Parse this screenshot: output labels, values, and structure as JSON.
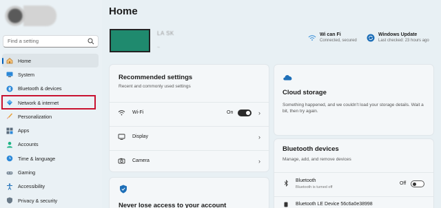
{
  "search": {
    "placeholder": "Find a setting"
  },
  "sidebar": {
    "items": [
      {
        "label": "Home",
        "icon": "home-icon",
        "active": true
      },
      {
        "label": "System",
        "icon": "monitor-icon"
      },
      {
        "label": "Bluetooth & devices",
        "icon": "bluetooth-icon"
      },
      {
        "label": "Network & internet",
        "icon": "network-diamond-icon"
      },
      {
        "label": "Personalization",
        "icon": "brush-icon"
      },
      {
        "label": "Apps",
        "icon": "apps-grid-icon"
      },
      {
        "label": "Accounts",
        "icon": "person-icon"
      },
      {
        "label": "Time & language",
        "icon": "globe-clock-icon"
      },
      {
        "label": "Gaming",
        "icon": "gamepad-icon"
      },
      {
        "label": "Accessibility",
        "icon": "accessibility-icon"
      },
      {
        "label": "Privacy & security",
        "icon": "shield-icon"
      }
    ]
  },
  "main": {
    "title": "Home",
    "device_name": "LA         SK"
  },
  "status": {
    "wifi": {
      "title": "Wi can Fi",
      "sub": "Connected, secured"
    },
    "update": {
      "title": "Windows Update",
      "sub": "Last checked: 23 hours ago"
    }
  },
  "recommended": {
    "title": "Recommended settings",
    "sub": "Recent and commonly used settings",
    "rows": [
      {
        "label": "Wi-Fi",
        "state": "On"
      },
      {
        "label": "Display"
      },
      {
        "label": "Camera"
      }
    ]
  },
  "cloud": {
    "title": "Cloud storage",
    "body": "Something happened, and we couldn't load your storage details. Wait a bit, then try again."
  },
  "bluetooth": {
    "title": "Bluetooth devices",
    "sub": "Manage, add, and remove devices",
    "row_label": "Bluetooth",
    "row_sub": "Bluetooth is turned off",
    "row_state": "Off",
    "device": "Bluetooth LE Device 56c6a0e38998"
  },
  "account": {
    "title": "Never lose access to your account"
  },
  "colors": {
    "accent": "#005fb8",
    "highlight": "#c8102e",
    "device_bg": "#1f8a6e"
  }
}
